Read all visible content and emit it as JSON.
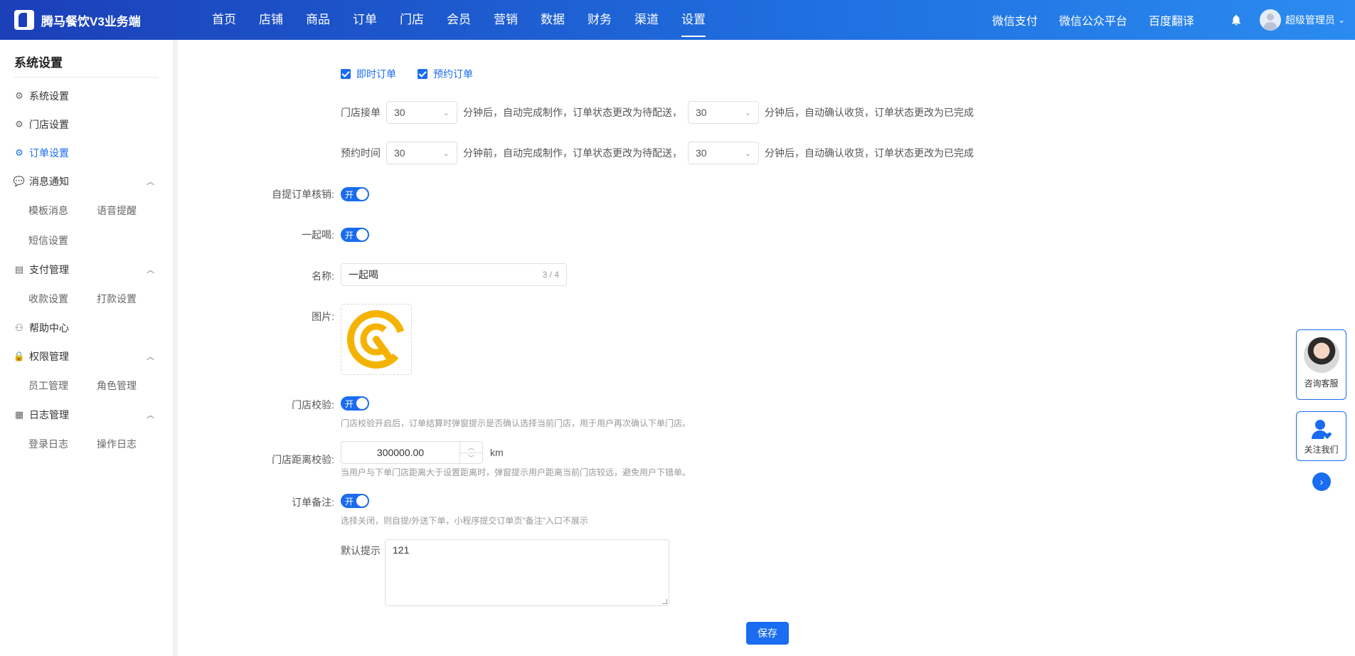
{
  "app": {
    "title": "腾马餐饮V3业务端"
  },
  "nav": {
    "items": [
      "首页",
      "店铺",
      "商品",
      "订单",
      "门店",
      "会员",
      "营销",
      "数据",
      "财务",
      "渠道",
      "设置"
    ],
    "active": "设置"
  },
  "topright": {
    "links": [
      "微信支付",
      "微信公众平台",
      "百度翻译"
    ],
    "user_name": "超级管理员"
  },
  "sidebar": {
    "title": "系统设置",
    "items": [
      {
        "label": "系统设置",
        "icon": "gear-icon"
      },
      {
        "label": "门店设置",
        "icon": "gear-icon"
      },
      {
        "label": "订单设置",
        "icon": "gear-icon",
        "active": true
      },
      {
        "label": "消息通知",
        "icon": "chat-icon",
        "expanded": true,
        "children": [
          "模板消息",
          "语音提醒",
          "短信设置"
        ]
      },
      {
        "label": "支付管理",
        "icon": "wallet-icon",
        "expanded": true,
        "children": [
          "收款设置",
          "打款设置"
        ]
      },
      {
        "label": "帮助中心",
        "icon": "user-icon"
      },
      {
        "label": "权限管理",
        "icon": "lock-icon",
        "expanded": true,
        "children": [
          "员工管理",
          "角色管理"
        ]
      },
      {
        "label": "日志管理",
        "icon": "log-icon",
        "expanded": true,
        "children": [
          "登录日志",
          "操作日志"
        ]
      }
    ]
  },
  "form": {
    "order_types": [
      {
        "label": "即时订单",
        "checked": true
      },
      {
        "label": "预约订单",
        "checked": true
      }
    ],
    "store_accept": {
      "prefix": "门店接单",
      "value1": "30",
      "mid": "分钟后，自动完成制作，订单状态更改为待配送，",
      "value2": "30",
      "suffix": "分钟后，自动确认收货，订单状态更改为已完成"
    },
    "reserve_time": {
      "prefix": "预约时间",
      "value1": "30",
      "mid": "分钟前，自动完成制作，订单状态更改为待配送，",
      "value2": "30",
      "suffix": "分钟后，自动确认收货，订单状态更改为已完成"
    },
    "self_pickup": {
      "label": "自提订单核销:",
      "switch_text": "开",
      "on": true
    },
    "drink_together": {
      "label": "一起喝:",
      "switch_text": "开",
      "on": true
    },
    "name": {
      "label": "名称:",
      "value": "一起喝",
      "counter": "3 / 4"
    },
    "image": {
      "label": "图片:"
    },
    "store_check": {
      "label": "门店校验:",
      "switch_text": "开",
      "on": true,
      "hint": "门店校验开启后，订单结算时弹窗提示是否确认选择当前门店，用于用户再次确认下单门店。"
    },
    "distance_check": {
      "label": "门店距离校验:",
      "value": "300000.00",
      "unit": "km",
      "hint": "当用户与下单门店距离大于设置距离时，弹窗提示用户距离当前门店较远，避免用户下错单。"
    },
    "order_remark": {
      "label": "订单备注:",
      "switch_text": "开",
      "on": true,
      "hint": "选择关闭，则自提/外送下单，小程序提交订单页\"备注\"入口不展示"
    },
    "default_hint": {
      "label": "默认提示",
      "value": "121"
    },
    "save_label": "保存"
  },
  "float": {
    "service_label": "咨询客服",
    "follow_label": "关注我们"
  },
  "colors": {
    "primary": "#1a6cf0",
    "logo_yellow": "#f5b301"
  }
}
